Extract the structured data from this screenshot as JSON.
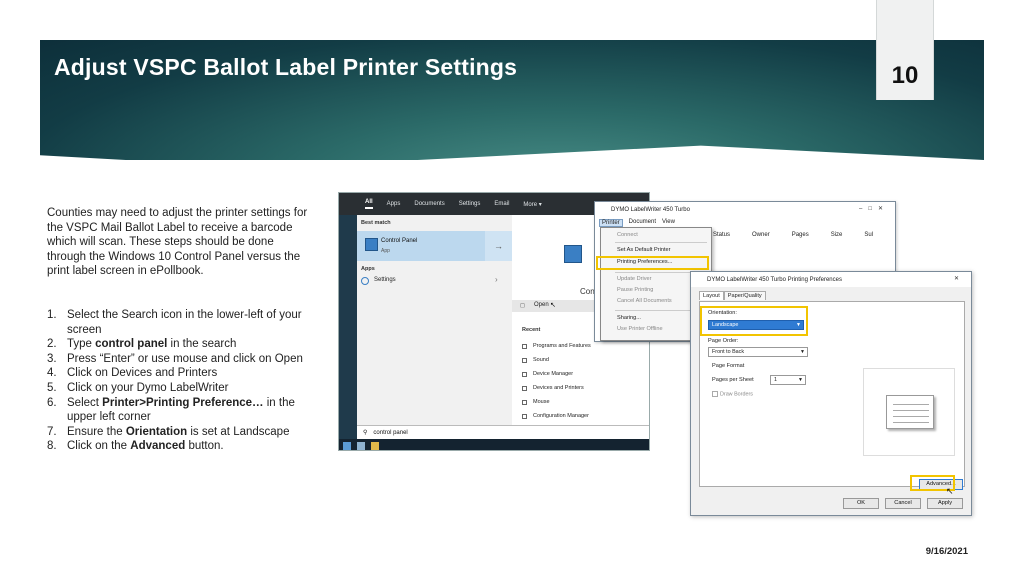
{
  "slide": {
    "title": "Adjust VSPC Ballot Label Printer Settings",
    "page_number": "10",
    "date": "9/16/2021"
  },
  "intro": "Counties may need to adjust the printer settings for the VSPC Mail Ballot Label to receive a barcode which will scan. These steps should be done through the Windows 10 Control Panel versus the print label screen in ePollbook.",
  "steps": [
    {
      "num": "1.",
      "pre": "Select the Search icon in the lower-left of your screen",
      "bold": "",
      "post": ""
    },
    {
      "num": "2.",
      "pre": "Type ",
      "bold": "control panel",
      "post": " in the search"
    },
    {
      "num": "3.",
      "pre": "Press “Enter” or use mouse and click on Open",
      "bold": "",
      "post": ""
    },
    {
      "num": "4.",
      "pre": "Click on Devices and Printers",
      "bold": "",
      "post": ""
    },
    {
      "num": "5.",
      "pre": "Click on your Dymo LabelWriter",
      "bold": "",
      "post": ""
    },
    {
      "num": "6.",
      "pre": " Select ",
      "bold": "Printer>Printing Preference…",
      "post": " in the upper left corner"
    },
    {
      "num": "7.",
      "pre": "Ensure the ",
      "bold": "Orientation",
      "post": " is set at Landscape"
    },
    {
      "num": "8.",
      "pre": "Click on the ",
      "bold": "Advanced",
      "post": " button."
    }
  ],
  "search_screenshot": {
    "tabs": [
      "All",
      "Apps",
      "Documents",
      "Settings",
      "Email",
      "More ▾"
    ],
    "best_match_caption": "Best match",
    "best_match_title": "Control Panel",
    "best_match_sub": "App",
    "apps_caption": "Apps",
    "apps_item": "Settings",
    "right_title": "Con",
    "open_label": "Open",
    "recent_caption": "Recent",
    "recent_items": [
      "Programs and Features",
      "Sound",
      "Device Manager",
      "Devices and Printers",
      "Mouse",
      "Configuration Manager"
    ],
    "search_text": "control panel"
  },
  "queue_window": {
    "title": "DYMO LabelWriter 450 Turbo",
    "menu": [
      "Printer",
      "Document",
      "View"
    ],
    "columns": [
      "Status",
      "Owner",
      "Pages",
      "Size",
      "Sul"
    ],
    "dropdown": {
      "group1": [
        "Connect",
        "Set As Default Printer",
        "Printing Preferences..."
      ],
      "group2": [
        "Update Driver",
        "Pause Printing",
        "Cancel All Documents"
      ],
      "group3": [
        "Sharing...",
        "Use Printer Offline"
      ]
    }
  },
  "prefs_dialog": {
    "title": "DYMO LabelWriter 450 Turbo Printing Preferences",
    "tabs": [
      "Layout",
      "Paper/Quality"
    ],
    "orientation_label": "Orientation:",
    "orientation_value": "Landscape",
    "page_order_label": "Page Order:",
    "page_order_value": "Front to Back",
    "page_format_label": "Page Format",
    "pages_per_sheet_label": "Pages per Sheet",
    "pages_per_sheet_value": "1",
    "draw_borders_label": "Draw Borders",
    "advanced_label": "Advanced...",
    "ok_label": "OK",
    "cancel_label": "Cancel",
    "apply_label": "Apply"
  },
  "colors": {
    "highlight": "#f2c400",
    "banner_dark": "#0d2f3a",
    "banner_light": "#4a8f88",
    "selection": "#2f7bd3"
  }
}
